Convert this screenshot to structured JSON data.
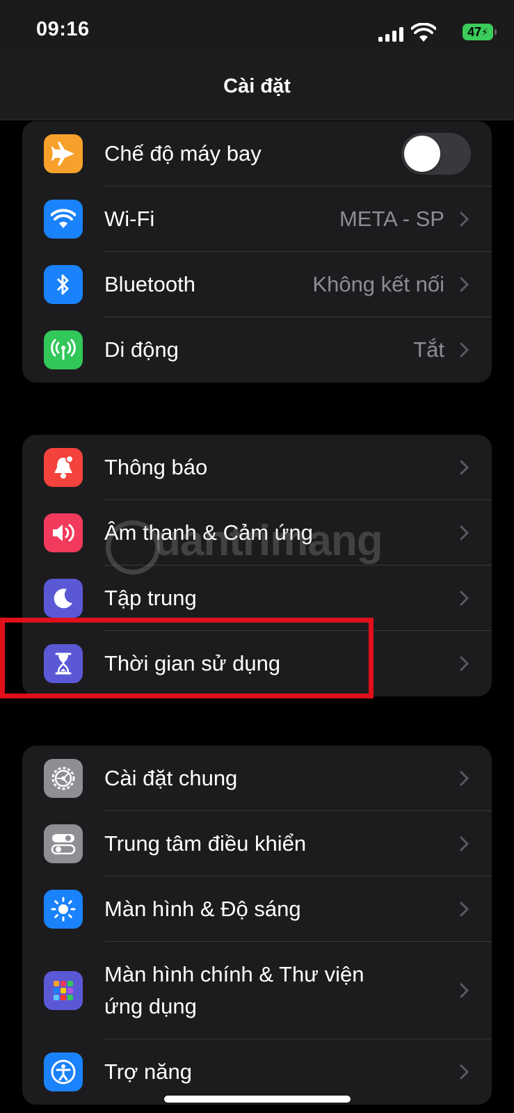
{
  "status_bar": {
    "time": "09:16",
    "battery": "47"
  },
  "nav": {
    "title": "Cài đặt"
  },
  "groups": [
    {
      "rows": [
        {
          "label": "Chế độ máy bay",
          "icon": "airplane-icon",
          "color": "#f7a12c",
          "toggle": "off"
        },
        {
          "label": "Wi-Fi",
          "value": "META - SP",
          "icon": "wifi-icon",
          "color": "#1a82fb"
        },
        {
          "label": "Bluetooth",
          "value": "Không kết nối",
          "icon": "bluetooth-icon",
          "color": "#1a82fb"
        },
        {
          "label": "Di động",
          "value": "Tắt",
          "icon": "cellular-icon",
          "color": "#32c759"
        }
      ]
    },
    {
      "rows": [
        {
          "label": "Thông báo",
          "icon": "notification-icon",
          "color": "#f4423c"
        },
        {
          "label": "Âm thanh & Cảm ứng",
          "icon": "sound-icon",
          "color": "#f23a5c"
        },
        {
          "label": "Tập trung",
          "icon": "moon-icon",
          "color": "#5b58d6"
        },
        {
          "label": "Thời gian sử dụng",
          "icon": "hourglass-icon",
          "color": "#5b58d6"
        }
      ]
    },
    {
      "rows": [
        {
          "label": "Cài đặt chung",
          "icon": "gear-icon",
          "color": "#8e8e93"
        },
        {
          "label": "Trung tâm điều khiển",
          "icon": "switches-icon",
          "color": "#8e8e93"
        },
        {
          "label": "Màn hình & Độ sáng",
          "icon": "brightness-icon",
          "color": "#1a82fb"
        },
        {
          "label": "Màn hình chính & Thư viện\nứng dụng",
          "icon": "home-screen-icon",
          "color": "#5b58d6"
        },
        {
          "label": "Trợ năng",
          "icon": "accessibility-icon",
          "color": "#1a82fb"
        }
      ]
    }
  ],
  "watermark": "uantrimang"
}
